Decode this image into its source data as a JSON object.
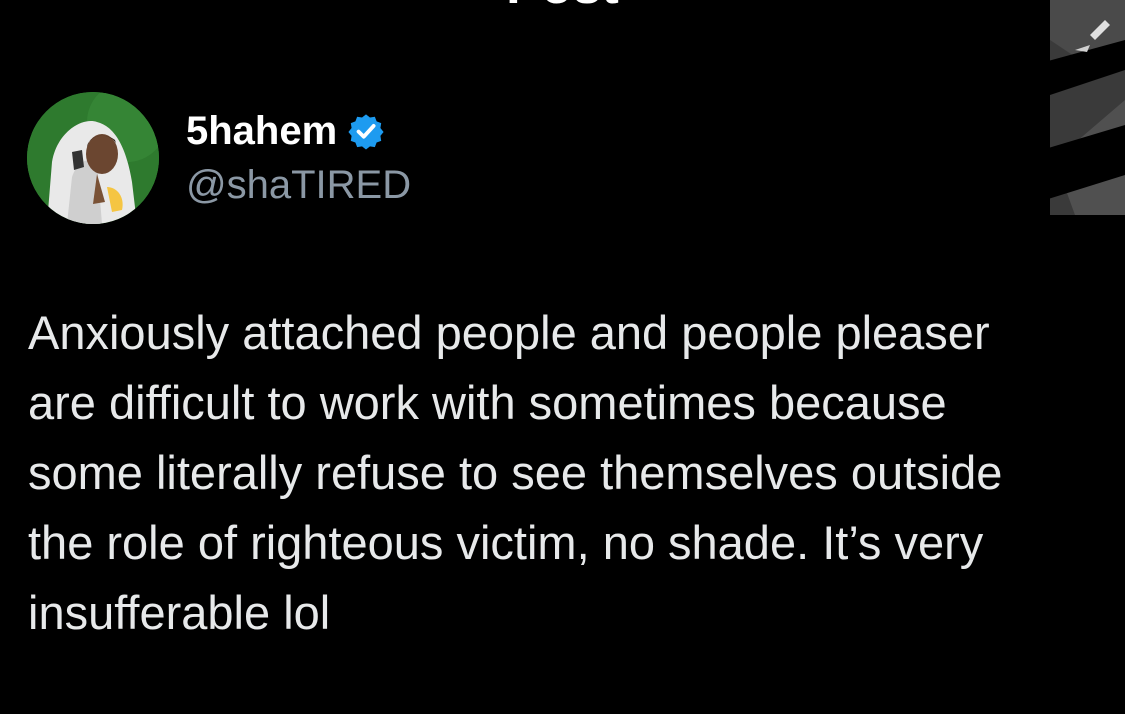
{
  "header": {
    "title": "Post"
  },
  "author": {
    "display_name": "5hahem",
    "handle": "@shaTIRED",
    "verified": true,
    "verified_color": "#1d9bf0",
    "avatar_icon": "avatar-photo"
  },
  "post": {
    "lines": [
      "Anxiously attached people and people pleaser",
      "are difficult to work with sometimes because",
      "some literally refuse to see themselves outside",
      "the role of righteous victim, no shade. It’s very",
      "insufferable lol"
    ]
  },
  "colors": {
    "background": "#000000",
    "primary_text": "#e7e9ea",
    "secondary_text": "#8b98a5",
    "accent": "#1d9bf0"
  }
}
